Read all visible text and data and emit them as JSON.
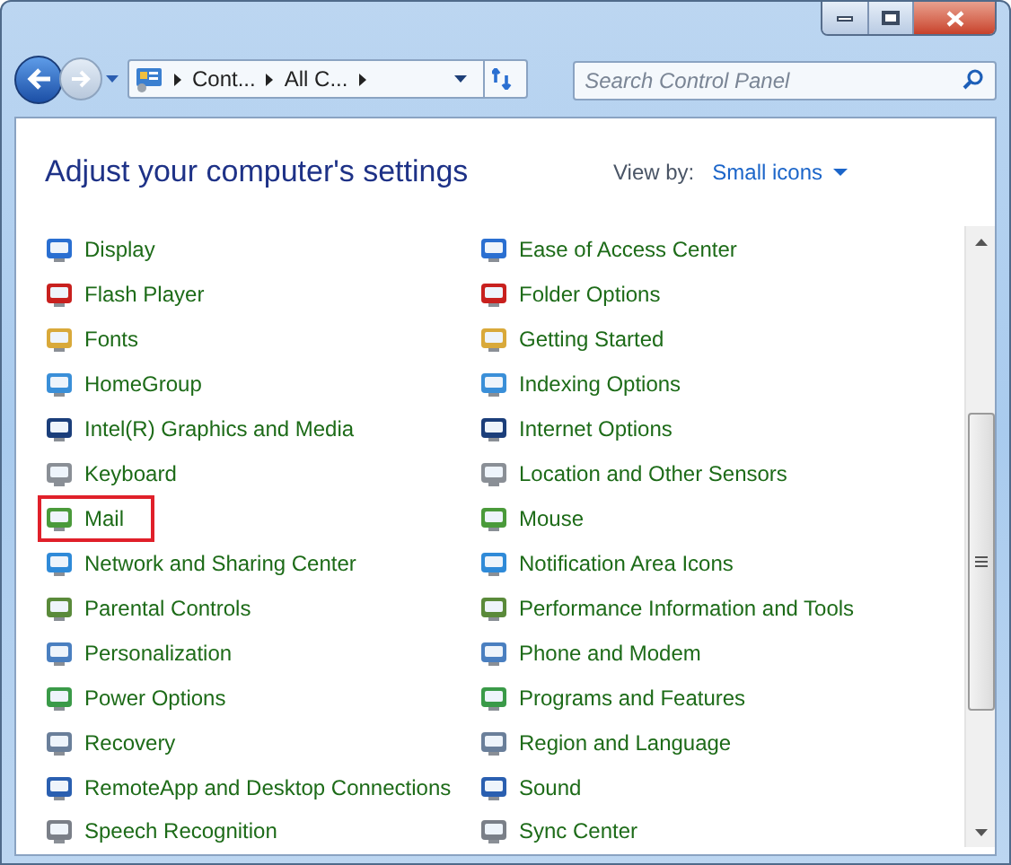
{
  "window": {
    "controls": [
      {
        "kind": "minimize"
      },
      {
        "kind": "maximize"
      },
      {
        "kind": "close"
      }
    ]
  },
  "navigation": {
    "breadcrumbs": [
      "Cont...",
      "All C..."
    ],
    "search": {
      "placeholder": "Search Control Panel"
    }
  },
  "header": {
    "title": "Adjust your computer's settings",
    "view_by_label": "View by:",
    "view_by_value": "Small icons"
  },
  "columns": [
    [
      {
        "label": "Display",
        "highlighted": false
      },
      {
        "label": "Flash Player",
        "highlighted": false
      },
      {
        "label": "Fonts",
        "highlighted": false
      },
      {
        "label": "HomeGroup",
        "highlighted": false
      },
      {
        "label": "Intel(R) Graphics and Media",
        "highlighted": false
      },
      {
        "label": "Keyboard",
        "highlighted": false
      },
      {
        "label": "Mail",
        "highlighted": true
      },
      {
        "label": "Network and Sharing Center",
        "highlighted": false
      },
      {
        "label": "Parental Controls",
        "highlighted": false
      },
      {
        "label": "Personalization",
        "highlighted": false
      },
      {
        "label": "Power Options",
        "highlighted": false
      },
      {
        "label": "Recovery",
        "highlighted": false
      },
      {
        "label": "RemoteApp and Desktop Connections",
        "highlighted": false
      },
      {
        "label": "Speech Recognition",
        "highlighted": false
      }
    ],
    [
      {
        "label": "Ease of Access Center",
        "highlighted": false
      },
      {
        "label": "Folder Options",
        "highlighted": false
      },
      {
        "label": "Getting Started",
        "highlighted": false
      },
      {
        "label": "Indexing Options",
        "highlighted": false
      },
      {
        "label": "Internet Options",
        "highlighted": false
      },
      {
        "label": "Location and Other Sensors",
        "highlighted": false
      },
      {
        "label": "Mouse",
        "highlighted": false
      },
      {
        "label": "Notification Area Icons",
        "highlighted": false
      },
      {
        "label": "Performance Information and Tools",
        "highlighted": false
      },
      {
        "label": "Phone and Modem",
        "highlighted": false
      },
      {
        "label": "Programs and Features",
        "highlighted": false
      },
      {
        "label": "Region and Language",
        "highlighted": false
      },
      {
        "label": "Sound",
        "highlighted": false
      },
      {
        "label": "Sync Center",
        "highlighted": false
      }
    ]
  ]
}
